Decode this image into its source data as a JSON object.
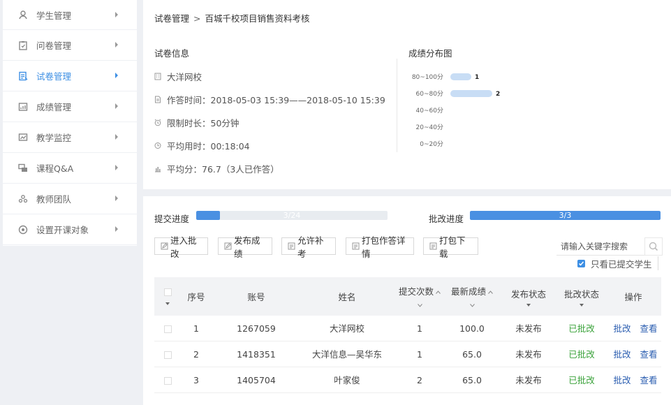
{
  "sidebar": {
    "items": [
      {
        "label": "学生管理",
        "icon": "student-icon"
      },
      {
        "label": "问卷管理",
        "icon": "questionnaire-icon"
      },
      {
        "label": "试卷管理",
        "icon": "exam-icon",
        "active": true
      },
      {
        "label": "成绩管理",
        "icon": "grades-icon"
      },
      {
        "label": "教学监控",
        "icon": "monitor-icon"
      },
      {
        "label": "课程Q&A",
        "icon": "qa-icon"
      },
      {
        "label": "教师团队",
        "icon": "team-icon"
      },
      {
        "label": "设置开课对象",
        "icon": "settings-target-icon"
      }
    ]
  },
  "breadcrumb": {
    "parent": "试卷管理",
    "separator": ">",
    "current": "百城千校项目销售资料考核"
  },
  "info": {
    "title": "试卷信息",
    "org": "大洋网校",
    "time": "作答时间：2018-05-03 15:39——2018-05-10 15:39",
    "limit": "限制时长：50分钟",
    "avg_time": "平均用时：00:18:04",
    "avg_score": "平均分：76.7（3人已作答）"
  },
  "chart_data": {
    "type": "bar",
    "title": "成绩分布图",
    "categories": [
      "80~100分",
      "60~80分",
      "40~60分",
      "20~40分",
      "0~20分"
    ],
    "values": [
      1,
      2,
      0,
      0,
      0
    ],
    "xlim": [
      0,
      2
    ],
    "orientation": "horizontal",
    "color": "#c8ddf5"
  },
  "progress": {
    "submit": {
      "label": "提交进度",
      "text": "3/24",
      "value": 0.125
    },
    "grade": {
      "label": "批改进度",
      "text": "3/3",
      "value": 1.0
    }
  },
  "toolbar": {
    "enter_grading": "进入批改",
    "publish": "发布成绩",
    "allow_retake": "允许补考",
    "pack_details": "打包作答详情",
    "pack_download": "打包下载",
    "search_placeholder": "请输入关键字搜索",
    "only_submitted": "只看已提交学生"
  },
  "table": {
    "headers": {
      "index": "序号",
      "account": "账号",
      "name": "姓名",
      "submit_count": "提交次数",
      "latest_score": "最新成绩",
      "publish_status": "发布状态",
      "grade_status": "批改状态",
      "actions": "操作"
    },
    "rows": [
      {
        "index": "1",
        "account": "1267059",
        "name": "大洋网校",
        "count": "1",
        "score": "100.0",
        "publish": "未发布",
        "grade": "已批改",
        "a1": "批改",
        "a2": "查看"
      },
      {
        "index": "2",
        "account": "1418351",
        "name": "大洋信息—吴华东",
        "count": "1",
        "score": "65.0",
        "publish": "未发布",
        "grade": "已批改",
        "a1": "批改",
        "a2": "查看"
      },
      {
        "index": "3",
        "account": "1405704",
        "name": "叶家俊",
        "count": "2",
        "score": "65.0",
        "publish": "未发布",
        "grade": "已批改",
        "a1": "批改",
        "a2": "查看"
      }
    ]
  },
  "colors": {
    "accent": "#3d8fe4",
    "progress": "#4a90e2",
    "green": "#3aa23a",
    "link": "#2a5db0"
  }
}
